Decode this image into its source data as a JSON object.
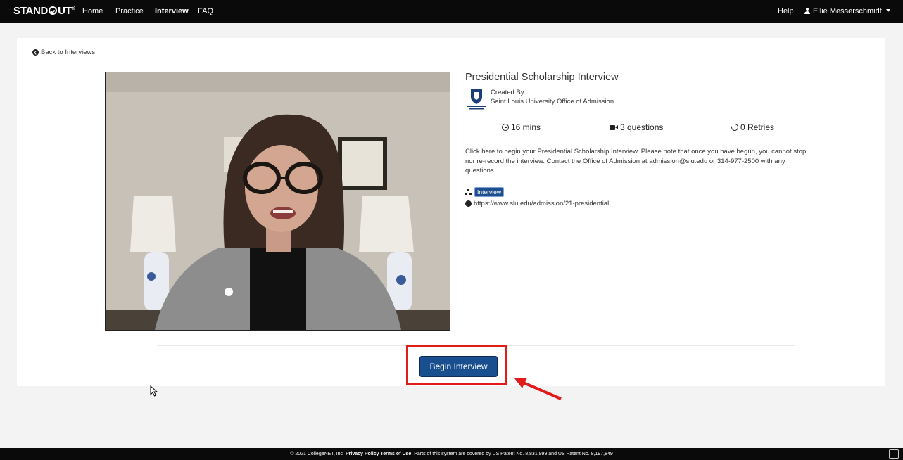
{
  "nav": {
    "logo_left": "STAND",
    "logo_right": "UT",
    "logo_mark": "®",
    "links": [
      "Home",
      "Practice",
      "Interview",
      "FAQ"
    ],
    "active": "Interview",
    "help": "Help",
    "user": "Ellie Messerschmidt"
  },
  "page": {
    "back_label": "Back to Interviews"
  },
  "interview": {
    "title": "Presidential Scholarship Interview",
    "created_by_label": "Created By",
    "creator": "Saint Louis University Office of Admission",
    "duration": "16 mins",
    "questions": "3 questions",
    "retries": "0 Retries",
    "description": "Click here to begin your Presidential Scholarship Interview. Please note that once you have begun, you cannot stop nor re-record the interview. Contact the Office of Admission at admission@slu.edu or 314-977-2500 with any questions.",
    "tag": "Interview",
    "url": "https://www.slu.edu/admission/21-presidential",
    "begin_label": "Begin Interview"
  },
  "footer": {
    "copyright": "© 2021 CollegeNET, Inc",
    "privacy": "Privacy Policy",
    "terms": "Terms of Use",
    "patent": "Parts of this system are covered by US Patent No. 8,831,999 and US Patent No. 9,197,849"
  },
  "colors": {
    "navbar": "#0a0a0a",
    "primary_button": "#1a4f8f",
    "highlight": "#e21b1b"
  },
  "icons": [
    "back-icon",
    "clock-icon",
    "video-camera-icon",
    "retry-icon",
    "sitemap-icon",
    "globe-icon",
    "user-icon",
    "caret-down-icon"
  ]
}
